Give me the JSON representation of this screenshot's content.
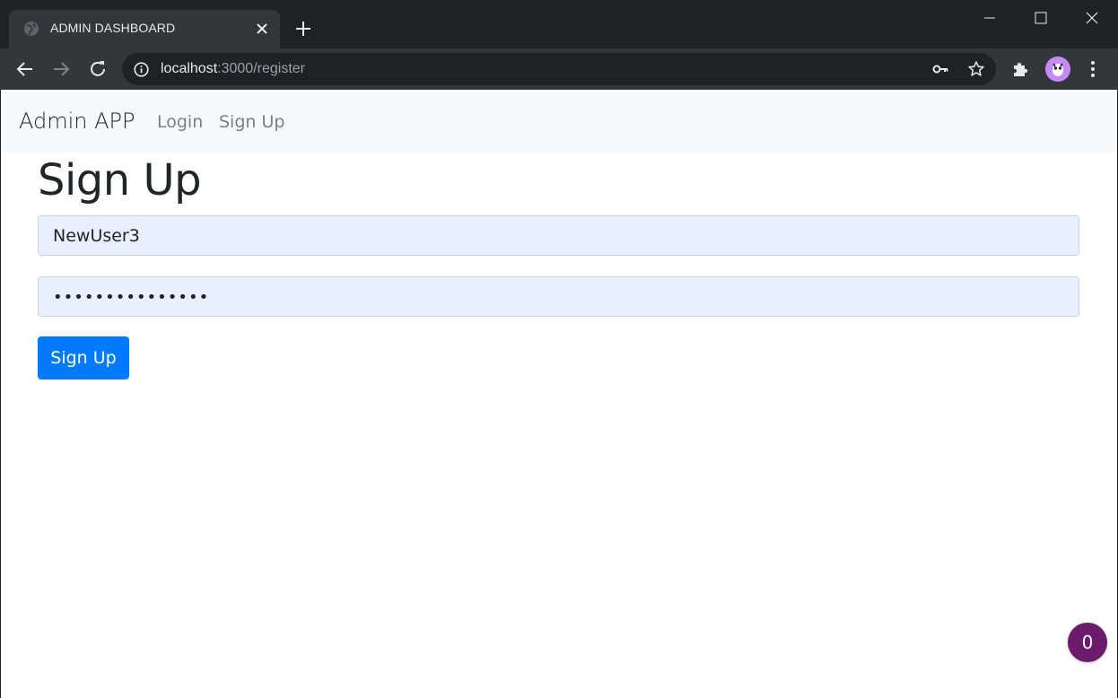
{
  "browser": {
    "tab_title": "ADMIN DASHBOARD",
    "url_host": "localhost",
    "url_path": ":3000/register",
    "icons": [
      "globe-icon",
      "close-icon",
      "plus-icon",
      "minimize-icon",
      "maximize-icon",
      "window-close-icon",
      "back-arrow-icon",
      "forward-arrow-icon",
      "reload-icon",
      "info-icon",
      "key-icon",
      "star-icon",
      "puzzle-icon",
      "profile-avatar",
      "more-vert-icon"
    ]
  },
  "navbar": {
    "brand": "Admin APP",
    "links": [
      {
        "label": "Login"
      },
      {
        "label": "Sign Up"
      }
    ]
  },
  "main": {
    "title": "Sign Up",
    "username_value": "NewUser3",
    "password_value": "•••••••••••••••",
    "submit_label": "Sign Up"
  },
  "floating_badge": {
    "count": "0"
  },
  "colors": {
    "primary": "#007bff",
    "navbar_bg": "#f8f9fa",
    "autofill_bg": "#e8f0fe",
    "badge_bg": "#6b1b6a",
    "chrome_dark": "#202124"
  }
}
